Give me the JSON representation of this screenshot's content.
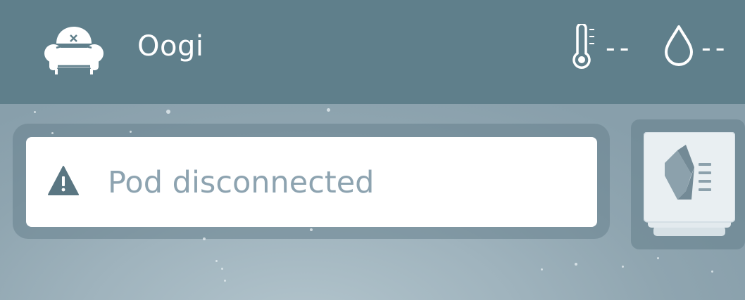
{
  "header": {
    "room_name": "Oogi",
    "room_icon": "armchair-icon",
    "temperature": {
      "icon": "thermometer-icon",
      "value": "--"
    },
    "humidity": {
      "icon": "water-drop-icon",
      "value": "--"
    }
  },
  "status": {
    "icon": "warning-icon",
    "message": "Pod disconnected"
  },
  "device": {
    "icon": "pod-device-icon"
  },
  "colors": {
    "header_bg": "#5f7f8b",
    "background": "#9fb3bd",
    "status_text": "#8da3b0",
    "warning_icon": "#5a7682",
    "card_bg": "#ffffff"
  }
}
